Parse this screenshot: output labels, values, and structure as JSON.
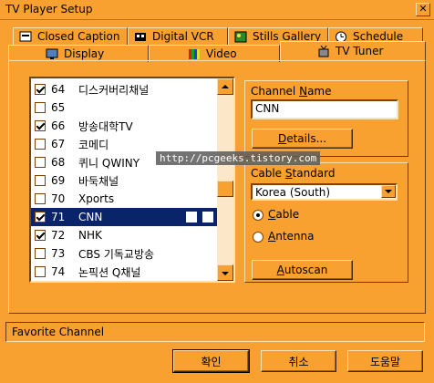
{
  "window": {
    "title": "TV Player Setup",
    "close_glyph": "✕"
  },
  "tabs_row1": [
    {
      "label": "Closed Caption",
      "icon": "closed-caption-icon"
    },
    {
      "label": "Digital VCR",
      "icon": "digital-vcr-icon"
    },
    {
      "label": "Stills Gallery",
      "icon": "stills-gallery-icon"
    },
    {
      "label": "Schedule",
      "icon": "schedule-icon"
    }
  ],
  "tabs_row2": [
    {
      "label": "Display",
      "icon": "display-icon"
    },
    {
      "label": "Video",
      "icon": "video-icon"
    },
    {
      "label": "TV Tuner",
      "icon": "tv-tuner-icon",
      "active": true
    }
  ],
  "channels": [
    {
      "num": "64",
      "name": "디스커버리채널",
      "checked": true
    },
    {
      "num": "65",
      "name": "",
      "checked": false
    },
    {
      "num": "66",
      "name": "방송대학TV",
      "checked": true
    },
    {
      "num": "67",
      "name": "코메디",
      "checked": false
    },
    {
      "num": "68",
      "name": "퀴니 QWINY",
      "checked": false
    },
    {
      "num": "69",
      "name": "바둑채널",
      "checked": false
    },
    {
      "num": "70",
      "name": "Xports",
      "checked": false
    },
    {
      "num": "71",
      "name": "CNN",
      "checked": true,
      "selected": true
    },
    {
      "num": "72",
      "name": "NHK",
      "checked": true
    },
    {
      "num": "73",
      "name": "CBS 기독교방송",
      "checked": false
    },
    {
      "num": "74",
      "name": "논픽션 Q채널",
      "checked": false
    }
  ],
  "channel_name": {
    "label": "Channel Name",
    "value": "CNN",
    "details_button": "Details..."
  },
  "cable_standard": {
    "label": "Cable Standard",
    "selected": "Korea (South)",
    "radio_cable": "Cable",
    "radio_antenna": "Antenna",
    "mode": "Cable",
    "autoscan_button": "Autoscan"
  },
  "watermark": "http://pcgeeks.tistory.com",
  "status": "Favorite Channel",
  "buttons": {
    "ok": "확인",
    "cancel": "취소",
    "help": "도움말"
  },
  "colors": {
    "face": "#F8A030",
    "highlight": "#0A246A"
  }
}
